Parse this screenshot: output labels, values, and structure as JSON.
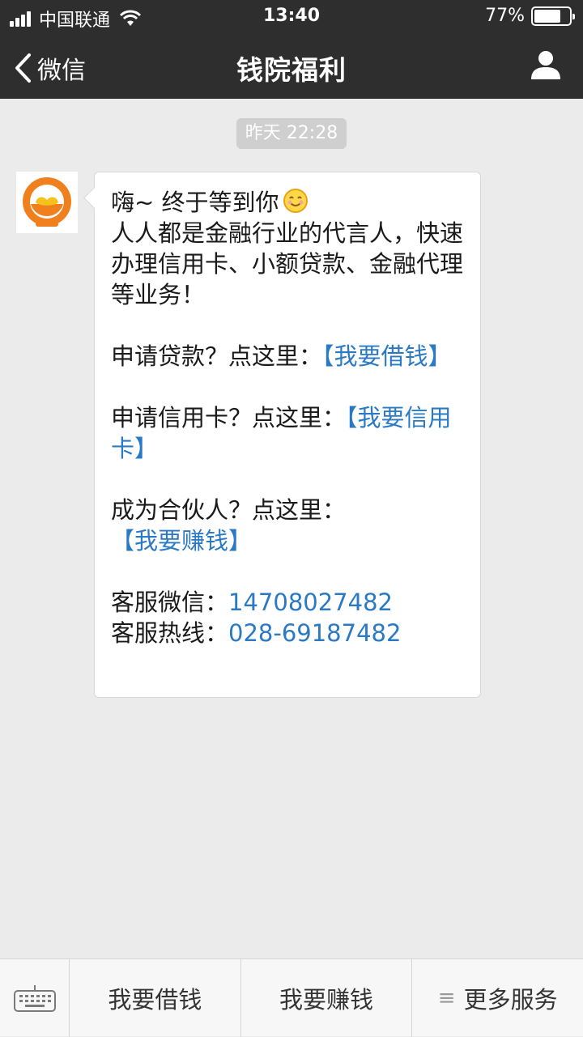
{
  "status_bar": {
    "carrier": "中国联通",
    "time": "13:40",
    "battery_text": "77%",
    "battery_level": 0.77
  },
  "nav": {
    "back_label": "微信",
    "title": "钱院福利"
  },
  "chat": {
    "timestamp": "昨天 22:28",
    "message": {
      "greeting": "嗨~ 终于等到你",
      "intro": "人人都是金融行业的代言人，快速办理信用卡、小额贷款、金融代理等业务！",
      "loan_prompt": "申请贷款？点这里：",
      "loan_link": "【我要借钱】",
      "card_prompt": "申请信用卡？点这里：",
      "card_link": "【我要信用卡】",
      "partner_prompt": "成为合伙人？点这里：",
      "partner_link": "【我要赚钱】",
      "wechat_label": "客服微信：",
      "wechat_value": "14708027482",
      "hotline_label": "客服热线：",
      "hotline_value": "028-69187482"
    }
  },
  "bottom_menu": {
    "items": [
      {
        "label": "我要借钱"
      },
      {
        "label": "我要赚钱"
      },
      {
        "label": "更多服务"
      }
    ]
  },
  "colors": {
    "bar_bg": "#2e2e2e",
    "chat_bg": "#ebebeb",
    "link": "#2a79c4",
    "avatar_orange": "#f07f1e"
  }
}
